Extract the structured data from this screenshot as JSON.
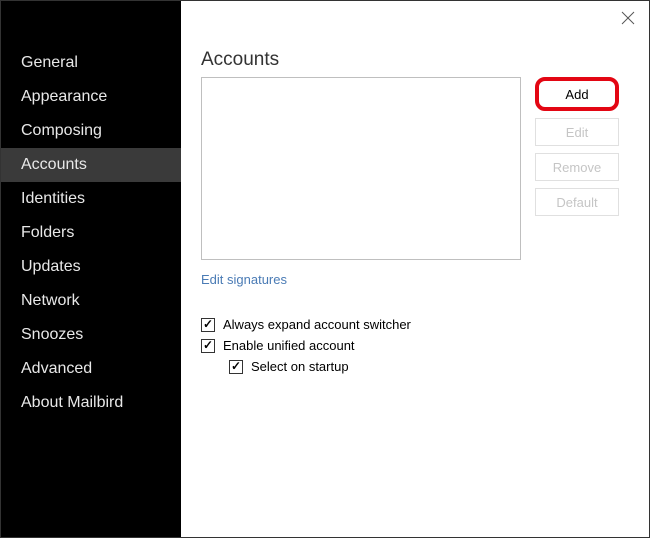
{
  "sidebar": {
    "items": [
      {
        "label": "General"
      },
      {
        "label": "Appearance"
      },
      {
        "label": "Composing"
      },
      {
        "label": "Accounts",
        "active": true
      },
      {
        "label": "Identities"
      },
      {
        "label": "Folders"
      },
      {
        "label": "Updates"
      },
      {
        "label": "Network"
      },
      {
        "label": "Snoozes"
      },
      {
        "label": "Advanced"
      },
      {
        "label": "About Mailbird"
      }
    ]
  },
  "main": {
    "title": "Accounts",
    "buttons": {
      "add": "Add",
      "edit": "Edit",
      "remove": "Remove",
      "default": "Default"
    },
    "edit_signatures_link": "Edit signatures",
    "checks": {
      "always_expand": "Always expand account switcher",
      "enable_unified": "Enable unified account",
      "select_on_startup": "Select on startup"
    }
  }
}
